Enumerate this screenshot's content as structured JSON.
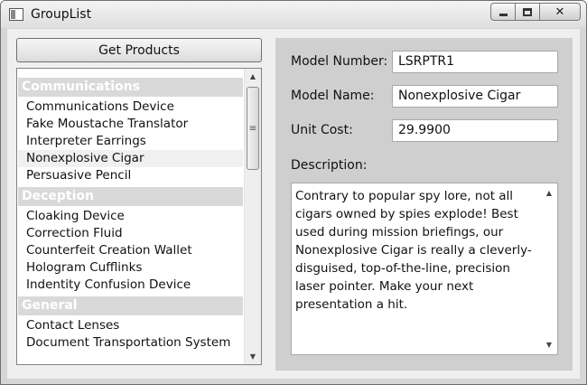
{
  "window": {
    "title": "GroupList"
  },
  "toolbar": {
    "get_products_label": "Get Products"
  },
  "list": {
    "groups": [
      {
        "name": "Communications",
        "items": [
          "Communications Device",
          "Fake Moustache Translator",
          "Interpreter Earrings",
          "Nonexplosive Cigar",
          "Persuasive Pencil"
        ]
      },
      {
        "name": "Deception",
        "items": [
          "Cloaking Device",
          "Correction Fluid",
          "Counterfeit Creation Wallet",
          "Hologram Cufflinks",
          "Indentity Confusion Device"
        ]
      },
      {
        "name": "General",
        "items": [
          "Contact Lenses",
          "Document Transportation System"
        ]
      }
    ],
    "selected_item": "Nonexplosive Cigar"
  },
  "details": {
    "model_number_label": "Model Number:",
    "model_number": "LSRPTR1",
    "model_name_label": "Model Name:",
    "model_name": "Nonexplosive Cigar",
    "unit_cost_label": "Unit Cost:",
    "unit_cost": "29.9900",
    "description_label": "Description:",
    "description": "Contrary to popular spy lore, not all cigars owned by spies explode! Best used during mission briefings, our Nonexplosive Cigar is really a cleverly-disguised, top-of-the-line, precision laser pointer. Make your next presentation a hit."
  },
  "icons": {
    "app": "window-icon",
    "minimize": "minimize-icon",
    "maximize": "maximize-icon",
    "close": "close-icon",
    "scroll_up": "up-arrow-icon",
    "scroll_down": "down-arrow-icon"
  },
  "colors": {
    "group_header_bg": "#d9d9d9",
    "detail_panel_bg": "#cfcfcf",
    "window_bg": "#efefef"
  }
}
